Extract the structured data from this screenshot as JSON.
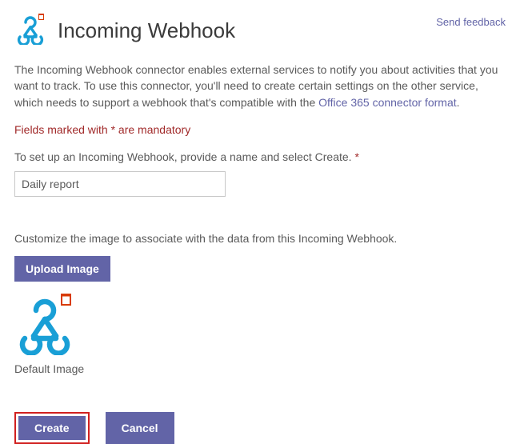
{
  "header": {
    "title": "Incoming Webhook",
    "feedback": "Send feedback"
  },
  "description": {
    "part1": "The Incoming Webhook connector enables external services to notify you about activities that you want to track. To use this connector, you'll need to create certain settings on the other service, which needs to support a webhook that's compatible with the ",
    "link": "Office 365 connector format",
    "part2": "."
  },
  "mandatory_note": "Fields marked with * are mandatory",
  "setup_label": "To set up an Incoming Webhook, provide a name and select Create. ",
  "setup_asterisk": "*",
  "name_value": "Daily report",
  "customize_label": "Customize the image to associate with the data from this Incoming Webhook.",
  "upload_label": "Upload Image",
  "image_caption": "Default Image",
  "buttons": {
    "create": "Create",
    "cancel": "Cancel"
  }
}
